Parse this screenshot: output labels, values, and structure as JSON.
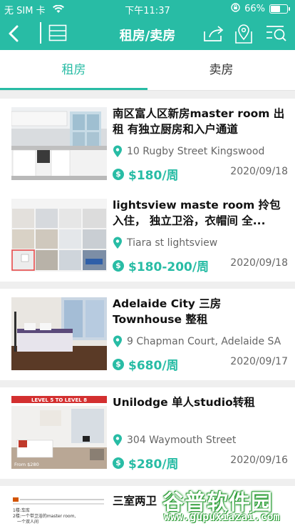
{
  "status_bar": {
    "carrier": "无 SIM 卡",
    "time": "下午11:37",
    "battery": "66%",
    "battery_level": 0.66
  },
  "nav": {
    "title": "租房/卖房",
    "icons": [
      "back-icon",
      "list-view-icon",
      "share-icon",
      "map-pin-icon",
      "filter-search-icon"
    ]
  },
  "tabs": [
    {
      "label": "租房",
      "active": true
    },
    {
      "label": "卖房",
      "active": false
    }
  ],
  "listings": [
    {
      "title": "南区富人区新房master room 出租 有独立厨房和入户通道",
      "address": "10 Rugby Street Kingswood",
      "price": "$180/周",
      "date": "2020/09/18"
    },
    {
      "title": "lightsview maste room 拎包入住， 独立卫浴，衣帽间 全...",
      "address": "Tiara st lightsview",
      "price": "$180-200/周",
      "date": "2020/09/18"
    },
    {
      "title": "Adelaide City 三房Townhouse 整租",
      "address": "9 Chapman Court, Adelaide SA",
      "price": "$680/周",
      "date": "2020/09/17"
    },
    {
      "title": "Unilodge 单人studio转租",
      "address": "304 Waymouth Street",
      "price": "$280/周",
      "date": "2020/09/16"
    },
    {
      "title": "三室两卫",
      "address": "",
      "price": "",
      "date": ""
    }
  ],
  "thumb_text": {
    "unilodge_banner": "LEVEL 5 TO LEVEL 8",
    "unilodge_price": "From $280",
    "partial_line1": "1楼:车库",
    "partial_line2": "2楼:一个带卫浴的master room,",
    "partial_line3": "一个双人间"
  },
  "watermark": {
    "brand": "谷普软件园",
    "url": "www.gupuxiazai.com"
  },
  "colors": {
    "accent": "#28bca5",
    "background": "#efefef"
  }
}
